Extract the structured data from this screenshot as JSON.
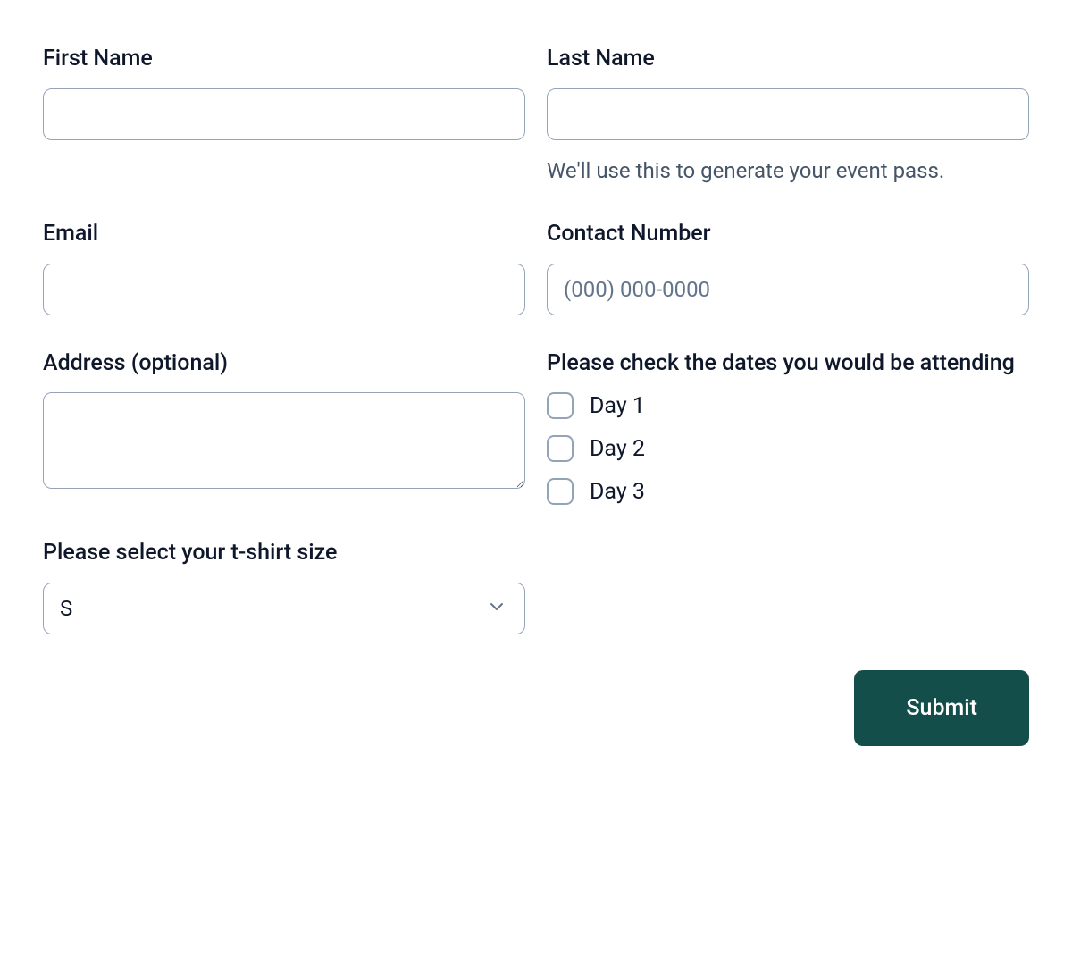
{
  "fields": {
    "first_name": {
      "label": "First Name"
    },
    "last_name": {
      "label": "Last Name",
      "help": "We'll use this to generate your event pass."
    },
    "email": {
      "label": "Email"
    },
    "phone": {
      "label": "Contact Number",
      "placeholder": "(000) 000-0000"
    },
    "address": {
      "label": "Address (optional)"
    },
    "dates": {
      "label": "Please check the dates you would be attending",
      "options": [
        "Day 1",
        "Day 2",
        "Day 3"
      ]
    },
    "shirt": {
      "label": "Please select your t-shirt size",
      "selected": "S"
    }
  },
  "actions": {
    "submit": "Submit"
  },
  "colors": {
    "text": "#0f172a",
    "muted": "#475569",
    "border": "#94a3b8",
    "primary": "#134e4a"
  }
}
